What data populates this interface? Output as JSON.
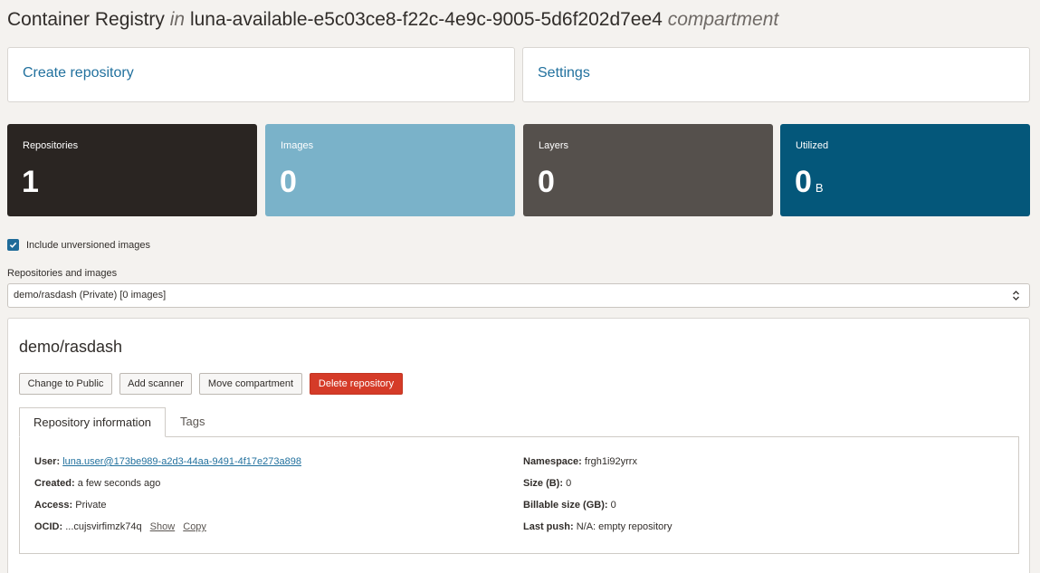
{
  "header": {
    "title": "Container Registry",
    "in_word": "in",
    "compartment_name": "luna-available-e5c03ce8-f22c-4e9c-9005-5d6f202d7ee4",
    "compartment_word": "compartment"
  },
  "actions": {
    "create": "Create repository",
    "settings": "Settings"
  },
  "stats": [
    {
      "label": "Repositories",
      "value": "1",
      "unit": "",
      "color": "#2a2522"
    },
    {
      "label": "Images",
      "value": "0",
      "unit": "",
      "color": "#7ab2c9"
    },
    {
      "label": "Layers",
      "value": "0",
      "unit": "",
      "color": "#55504c"
    },
    {
      "label": "Utilized",
      "value": "0",
      "unit": "B",
      "color": "#04577a"
    }
  ],
  "filter": {
    "include_unversioned_label": "Include unversioned images",
    "include_unversioned_checked": true
  },
  "selector": {
    "label": "Repositories and images",
    "value": "demo/rasdash (Private) [0 images]"
  },
  "repo": {
    "name": "demo/rasdash",
    "buttons": {
      "change_public": "Change to Public",
      "add_scanner": "Add scanner",
      "move_compartment": "Move compartment",
      "delete": "Delete repository"
    },
    "tabs": {
      "info": "Repository information",
      "tags": "Tags"
    },
    "info": {
      "user_label": "User:",
      "user_value": "luna.user@173be989-a2d3-44aa-9491-4f17e273a898",
      "created_label": "Created:",
      "created_value": "a few seconds ago",
      "access_label": "Access:",
      "access_value": "Private",
      "ocid_label": "OCID:",
      "ocid_value": "...cujsvirfimzk74q",
      "ocid_show": "Show",
      "ocid_copy": "Copy",
      "namespace_label": "Namespace:",
      "namespace_value": "frgh1i92yrrx",
      "size_label": "Size (B):",
      "size_value": "0",
      "billable_label": "Billable size (GB):",
      "billable_value": "0",
      "lastpush_label": "Last push:",
      "lastpush_value": "N/A: empty repository"
    }
  }
}
